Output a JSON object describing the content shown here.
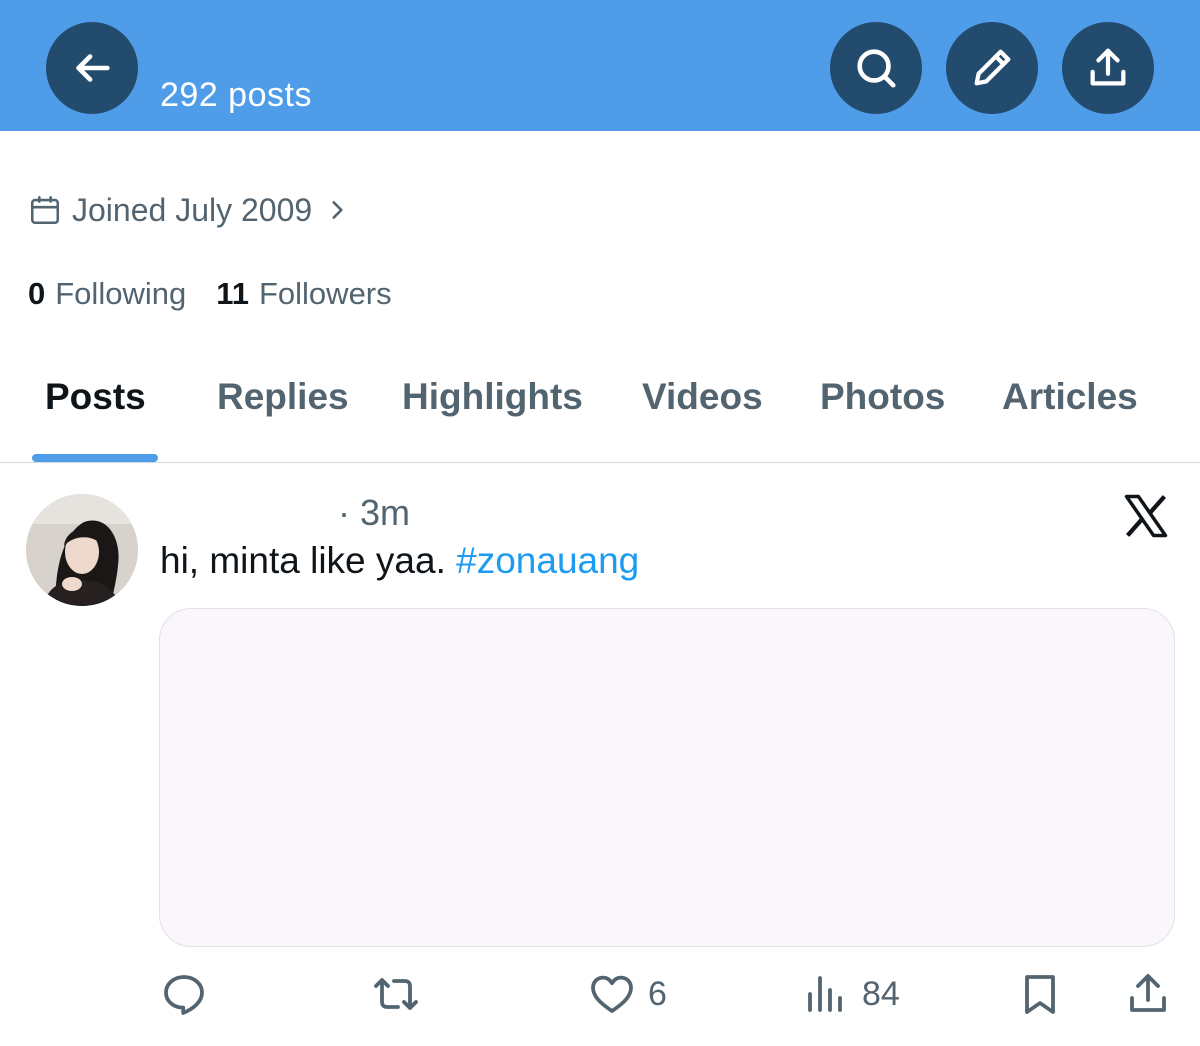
{
  "header": {
    "post_count": "292 posts",
    "back_icon": "arrow-left-icon",
    "search_icon": "search-icon",
    "edit_icon": "pencil-icon",
    "share_icon": "share-icon",
    "accent_color": "#4f9de9",
    "button_color": "#234b6e"
  },
  "profile": {
    "joined": "Joined July 2009",
    "following_count": "0",
    "following_label": "Following",
    "followers_count": "11",
    "followers_label": "Followers"
  },
  "tabs": [
    {
      "label": "Posts",
      "active": true
    },
    {
      "label": "Replies",
      "active": false
    },
    {
      "label": "Highlights",
      "active": false
    },
    {
      "label": "Videos",
      "active": false
    },
    {
      "label": "Photos",
      "active": false
    },
    {
      "label": "Articles",
      "active": false
    }
  ],
  "post": {
    "time": "· 3m",
    "text": "hi, minta like yaa.",
    "hashtag": "#zonauang",
    "hashtag_color": "#1d9bf0",
    "actions": {
      "reply_icon": "reply-icon",
      "repost_icon": "repost-icon",
      "like_icon": "heart-icon",
      "like_count": "6",
      "views_icon": "views-icon",
      "views_count": "84",
      "bookmark_icon": "bookmark-icon",
      "share_icon": "share-icon"
    }
  }
}
